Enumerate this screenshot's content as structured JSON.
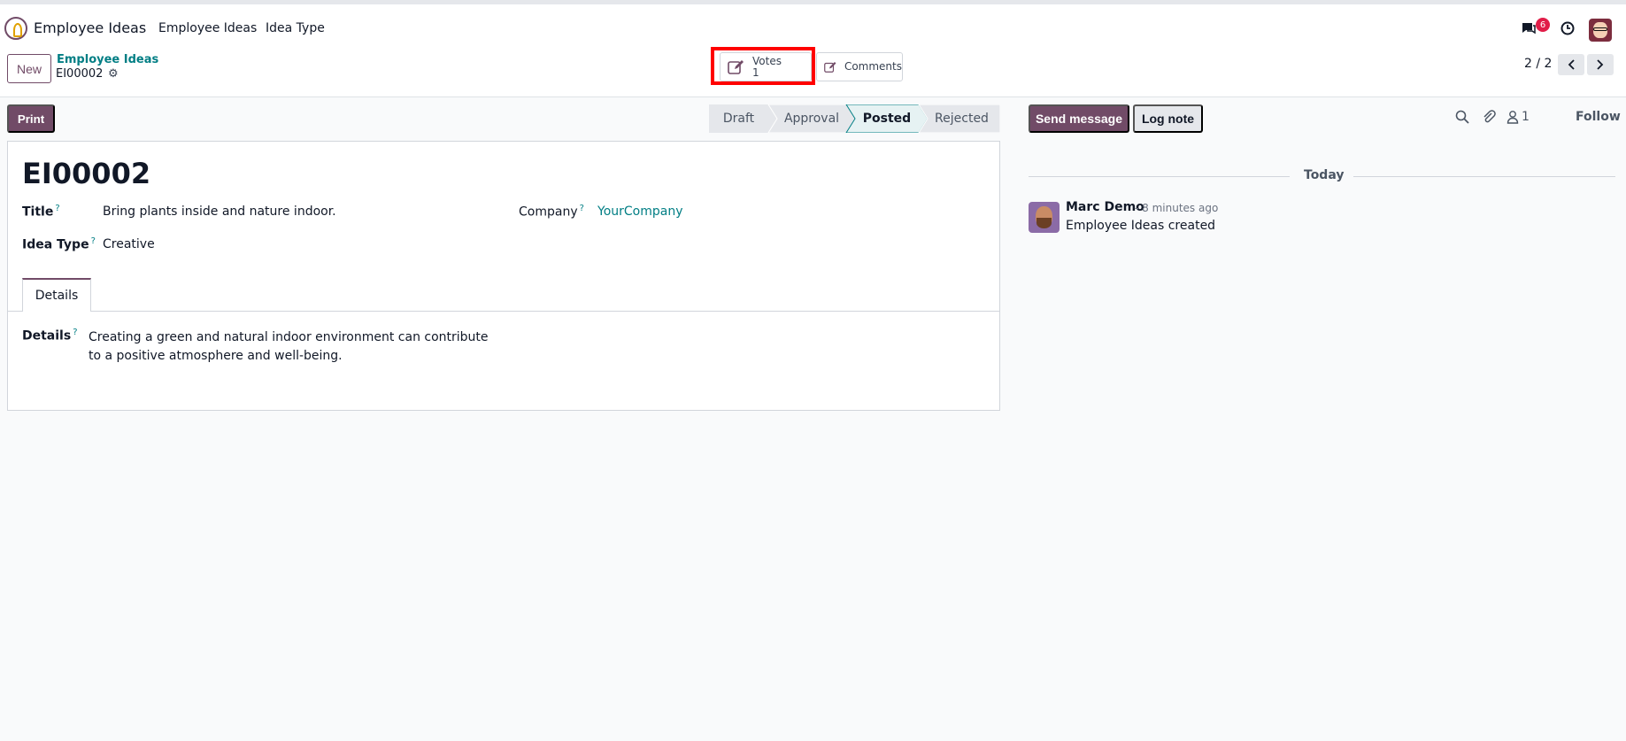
{
  "nav": {
    "app_name": "Employee Ideas",
    "menu": [
      "Employee Ideas",
      "Idea Type"
    ],
    "messages_badge": "6"
  },
  "control": {
    "new_label": "New",
    "breadcrumb": "Employee Ideas",
    "record_name": "EI00002",
    "smart_buttons": {
      "votes_label": "Votes",
      "votes_count": "1",
      "comments_label": "Comments"
    },
    "pager": "2 / 2"
  },
  "form": {
    "print_label": "Print",
    "stages": [
      "Draft",
      "Approval",
      "Posted",
      "Rejected"
    ],
    "active_stage": "Posted",
    "title": "EI00002",
    "fields": {
      "title_label": "Title",
      "title_value": "Bring plants inside and nature indoor.",
      "company_label": "Company",
      "company_value": "YourCompany",
      "idea_type_label": "Idea Type",
      "idea_type_value": "Creative",
      "help_mark": "?"
    },
    "tab_label": "Details",
    "details_label": "Details",
    "details_text": "Creating a green and natural indoor environment can contribute to a positive atmosphere and well-being."
  },
  "chatter": {
    "send_message": "Send message",
    "log_note": "Log note",
    "followers_count": "1",
    "follow": "Follow",
    "day_separator": "Today",
    "messages": [
      {
        "author": "Marc Demo",
        "time": "- 8 minutes ago",
        "body": "Employee Ideas created"
      }
    ]
  },
  "colors": {
    "brand": "#714b67",
    "link": "#017e84",
    "highlight": "#ff0000",
    "badge": "#e11d48"
  }
}
